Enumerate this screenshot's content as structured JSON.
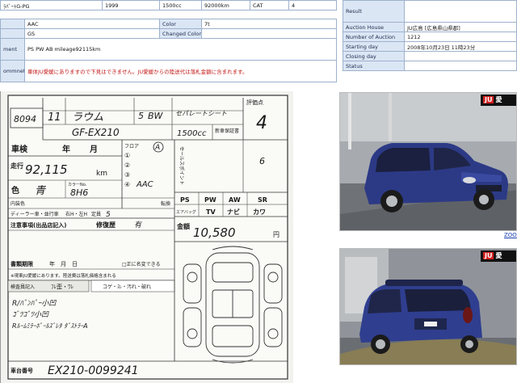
{
  "info_table": {
    "row1": {
      "model": "ﾗﾊﾞｰﾄG-PG",
      "year": "1999",
      "cc": "1500cc",
      "mileage": "92000km",
      "cat_label": "CAT",
      "cat_value": "4"
    },
    "row2": {
      "label": "Color",
      "value1": "AAC",
      "value2": "7t"
    },
    "row3": {
      "label": "Changed Color",
      "value1": "GS",
      "value2": ""
    },
    "equipment_label": "ment",
    "equipment_value": "PS PW AB mileage92115km",
    "comment_label": "ommnet",
    "comment_value": "車体JU愛媛にありますので下見はできません。JU愛媛からの陸送代は落札金額に含まれます。"
  },
  "auction_table": {
    "result_label": "Result",
    "result_value": "",
    "rows": [
      {
        "label": "Auction House",
        "value": "JU広島 [広島県山県郡]"
      },
      {
        "label": "Number of Auction",
        "value": "1212"
      },
      {
        "label": "Starting day",
        "value": "2008年10月23日 11時23分"
      },
      {
        "label": "Closing day",
        "value": ""
      },
      {
        "label": "Status",
        "value": ""
      }
    ]
  },
  "sheet": {
    "lot_number": "8094",
    "year_hw": "11",
    "model_hw": "ラウム",
    "grade_prefix": "5",
    "grade_hw": "BW",
    "type_hw": "セパレートシート",
    "model_code_hw": "GF-EX210",
    "cc_hw": "1500cc",
    "score_label": "評価点",
    "score_hw": "4",
    "inspection_label": "車検",
    "year_label": "年",
    "month_label": "月",
    "mileage_label": "走行",
    "mileage_hw": "92,115",
    "km_unit": "km",
    "color_label": "色",
    "color_hw": "青",
    "color_code_label": "カラーNo.",
    "color_code_hw": "8H6",
    "interior_label": "内装色",
    "dealer_label": "ディーラー車・並行車",
    "steering_label": "右H・左H",
    "capacity_label": "定員",
    "capacity_hw": "5",
    "floor_label": "フロア",
    "floor_hw": "A",
    "circled_nums": [
      "①",
      "②",
      "③",
      "④"
    ],
    "aac_hw": "AAC",
    "shift_label": "転換",
    "notes_label": "注意事項(出品店記入)",
    "repair_label": "修復歴",
    "repair_hw": "有",
    "reg_period_label": "書類期限",
    "reg_period_date": "年　月　日",
    "owner_label": "□正に名変できる",
    "notice_label": "※現車JU愛媛にあります。陸送費は落札価格含まれる",
    "inspector_label": "検査員記入",
    "inspector_marks": "ﾌﾚ歪・ﾜﾚ",
    "inspector_marks2": "コゲ・ｽﾚ・汚れ・破れ",
    "handwritten_notes": [
      "R/ﾊﾞﾝﾊﾟｰ小凹",
      "ｺﾞﾂｺﾞﾂ小凹",
      "Rﾙｰﾑﾐﾗｰﾎﾟｰﾙｽﾞﾚﾀ ﾀﾞｽﾄﾗｰA"
    ],
    "chassis_label": "車台番号",
    "chassis_hw": "EX210-0099241",
    "equip_labels": [
      "PS",
      "PW",
      "AW",
      "SR",
      "エアバッグ",
      "TV",
      "ナビ",
      "カワ"
    ],
    "price_label": "金額",
    "price_hw": "10,580",
    "price_unit": "円",
    "seller_label": "セールスポイント",
    "seller_hw": "6",
    "seller_sub": "新車保証書"
  },
  "photos": {
    "badge_logo": "JU",
    "badge_text": "愛",
    "zoom_label": "ZOO"
  },
  "colors": {
    "label_bg": "#dbe6f5",
    "border": "#9db1cc",
    "comment_red": "#c41a1a",
    "car_blue": "#2f3f8f"
  }
}
